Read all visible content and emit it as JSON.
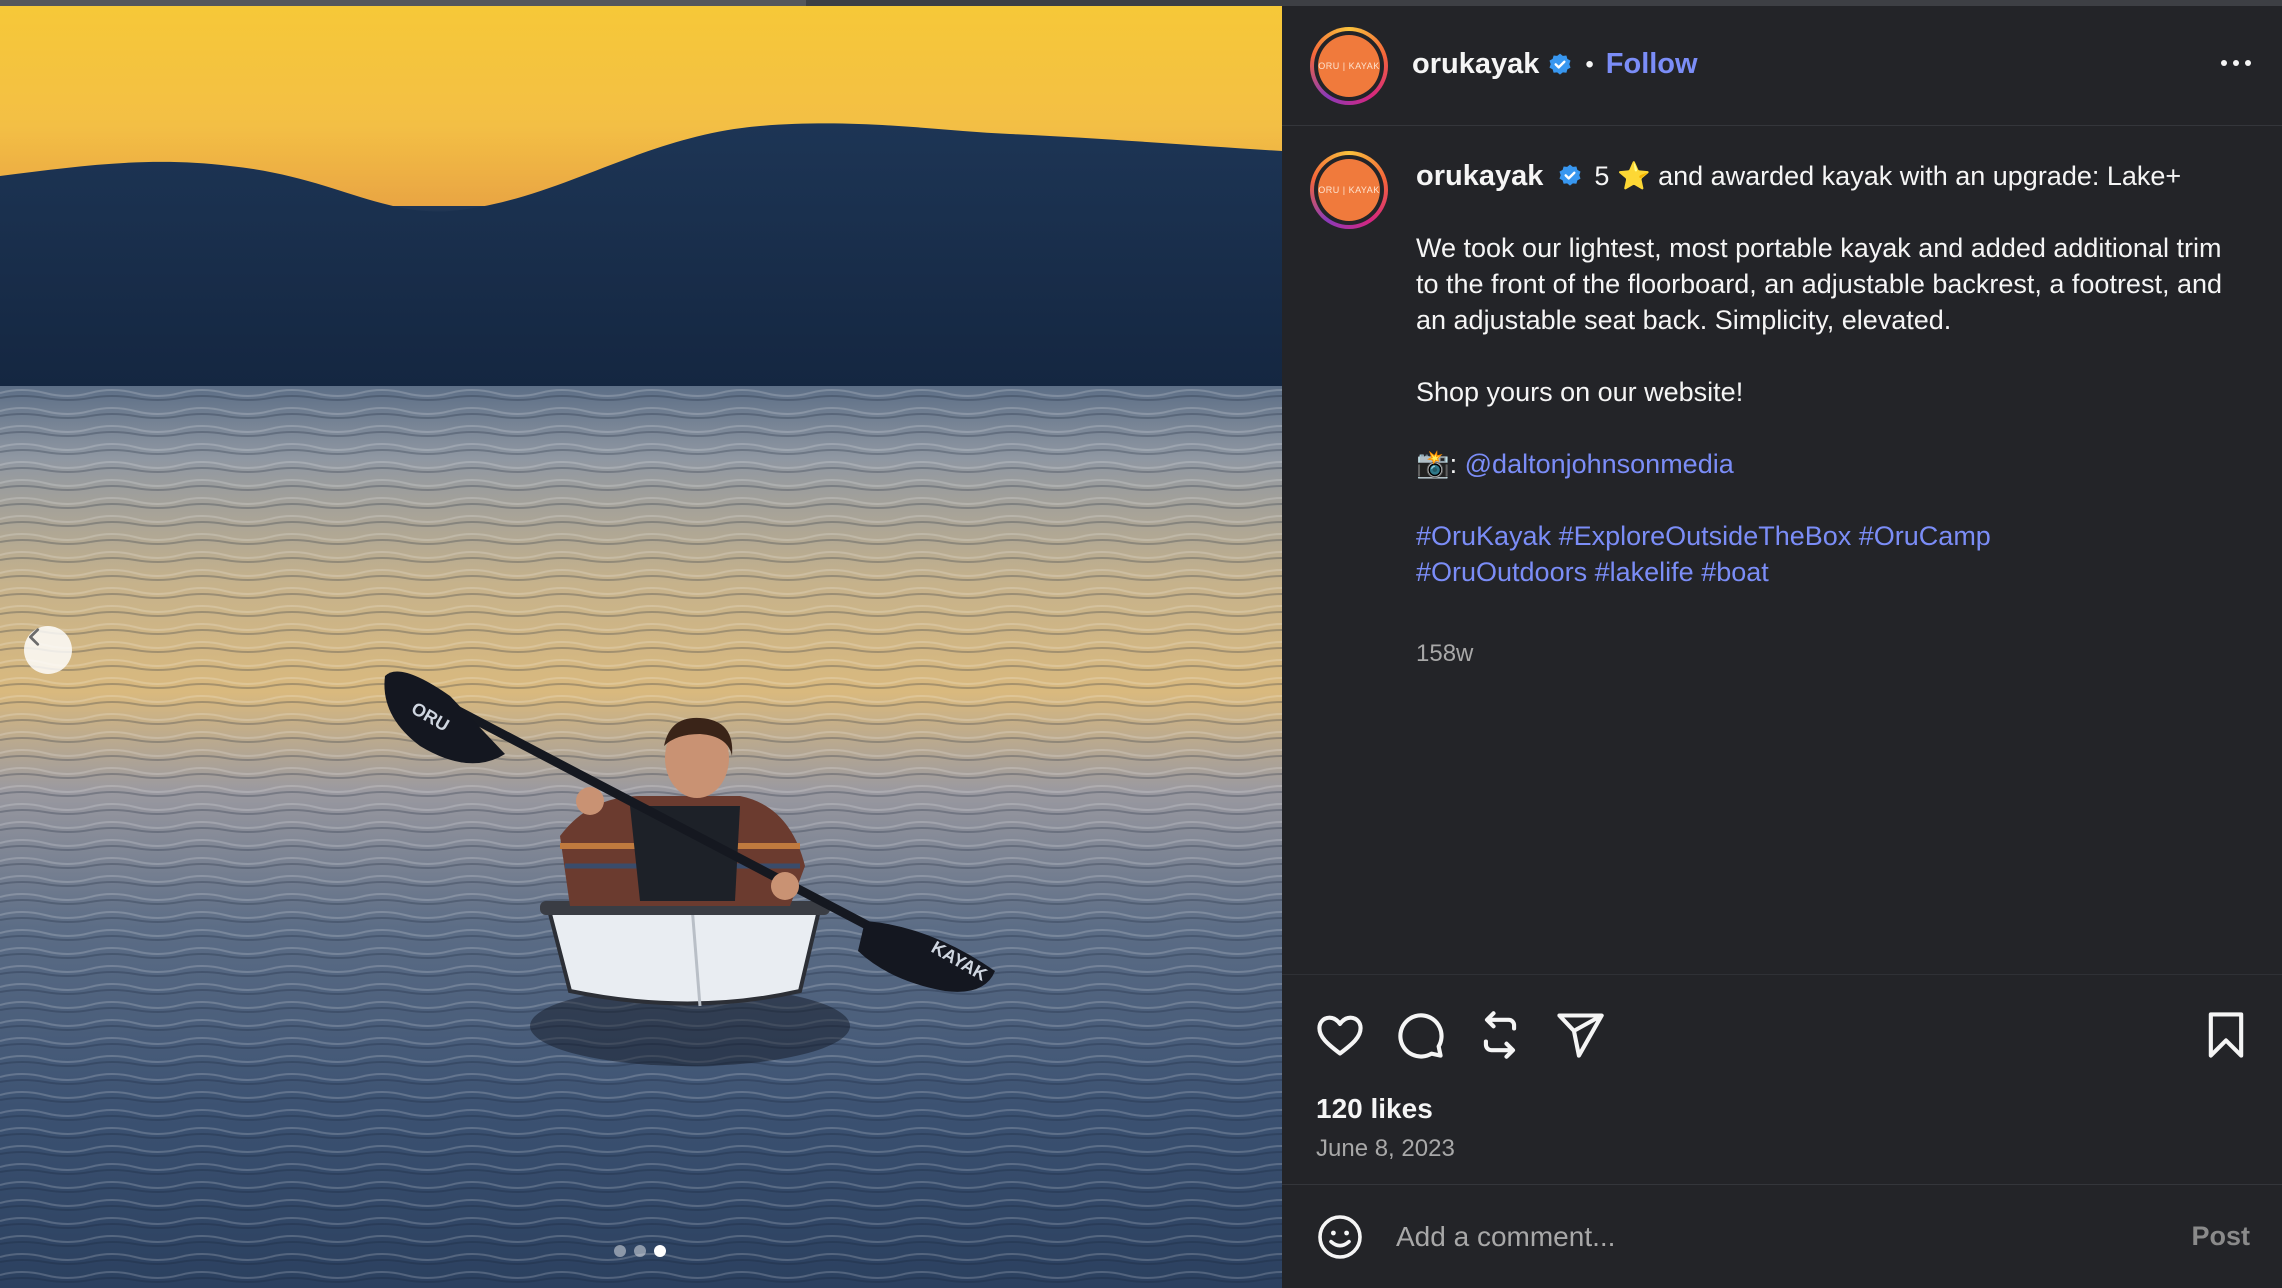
{
  "post": {
    "username": "orukayak",
    "follow_label": "Follow",
    "avatar_text": "ORU | KAYAK",
    "caption_lead": "5",
    "caption_star": "⭐",
    "caption_title_rest": " and awarded kayak with an upgrade: Lake+",
    "caption_body": "We took our lightest, most portable kayak and added additional trim to the front of the floorboard, an adjustable backrest, a footrest, and an adjustable seat back. Simplicity, elevated.",
    "caption_cta": "Shop yours on our website!",
    "credit_emoji": "📸",
    "credit_sep": ": ",
    "credit_handle": "@daltonjohnsonmedia",
    "hashtags_line1": [
      "#OruKayak",
      "#ExploreOutsideTheBox",
      "#OruCamp"
    ],
    "hashtags_line2": [
      "#OruOutdoors",
      "#lakelife",
      "#boat"
    ],
    "age": "158w",
    "likes": "120 likes",
    "date": "June 8, 2023",
    "paddle_text_left": "ORU",
    "paddle_text_right": "KAYAK"
  },
  "comment": {
    "placeholder": "Add a comment...",
    "post_label": "Post"
  },
  "carousel": {
    "total": 3,
    "active": 3
  },
  "colors": {
    "accent_link": "#7b8df7",
    "verified_blue": "#3897f0",
    "panel_bg": "#232428",
    "brand_orange": "#f07a3c"
  },
  "icons": [
    "chevron-left-icon",
    "verified-icon",
    "more-icon",
    "heart-icon",
    "comment-icon",
    "repost-icon",
    "share-icon",
    "bookmark-icon",
    "emoji-icon"
  ]
}
